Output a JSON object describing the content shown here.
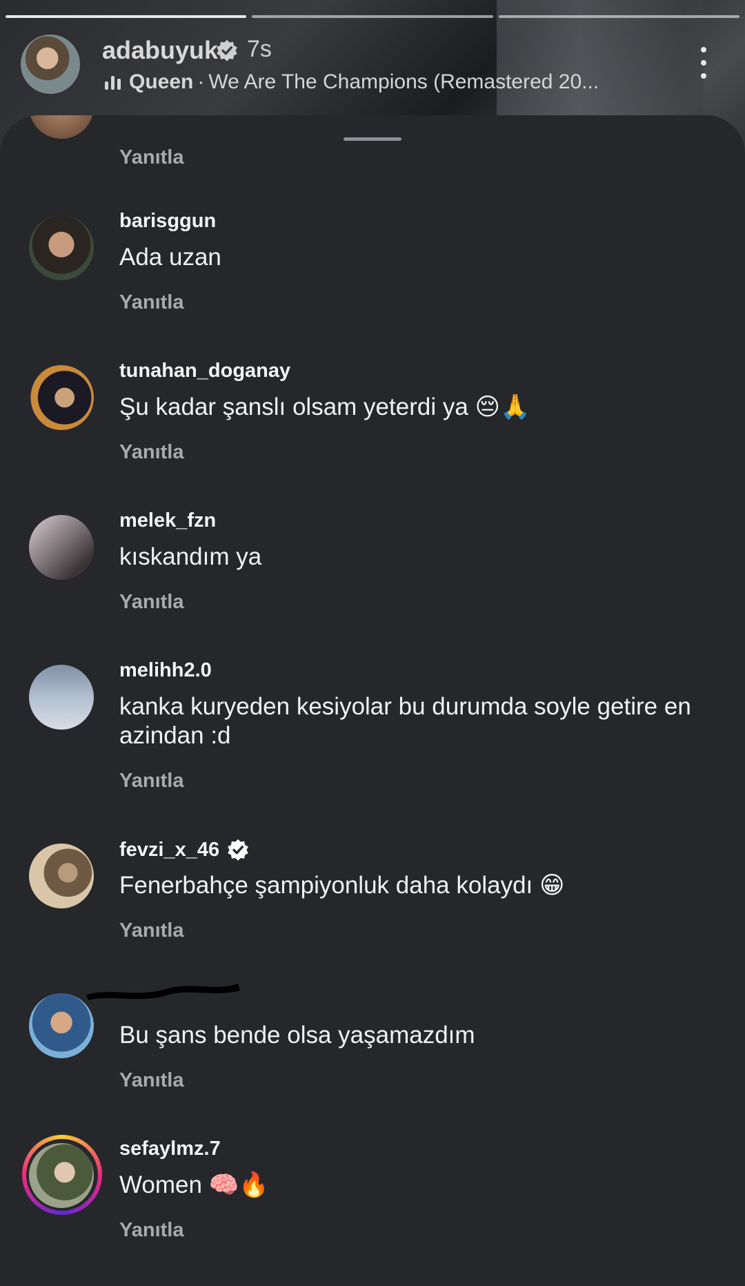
{
  "story": {
    "username": "adabuyuk",
    "time": "7s",
    "music_artist": "Queen",
    "music_separator": "·",
    "music_title": "We Are The Champions (Remastered 20..."
  },
  "comments": [
    {
      "username": "",
      "text": "",
      "reply": "Yanıtla"
    },
    {
      "username": "barisggun",
      "text": "Ada uzan",
      "reply": "Yanıtla"
    },
    {
      "username": "tunahan_doganay",
      "text": "Şu kadar şanslı olsam yeterdi ya 😔🙏",
      "reply": "Yanıtla"
    },
    {
      "username": "melek_fzn",
      "text": "kıskandım ya",
      "reply": "Yanıtla"
    },
    {
      "username": "melihh2.0",
      "text": "kanka kuryeden kesiyolar bu durumda soyle getire en azindan :d",
      "reply": "Yanıtla"
    },
    {
      "username": "fevzi_x_46",
      "text": "Fenerbahçe şampiyonluk daha kolaydı 😁",
      "reply": "Yanıtla"
    },
    {
      "username": "",
      "text": "Bu şans bende olsa yaşamazdım",
      "reply": "Yanıtla"
    },
    {
      "username": "sefaylmz.7",
      "text": "Women 🧠🔥",
      "reply": "Yanıtla"
    }
  ],
  "colors": {
    "sheet": "#26272b",
    "reply": "#a9a9ae",
    "verified": "#ffffff"
  },
  "icons": [
    "verified-badge-icon",
    "music-bars-icon",
    "more-options-icon"
  ]
}
